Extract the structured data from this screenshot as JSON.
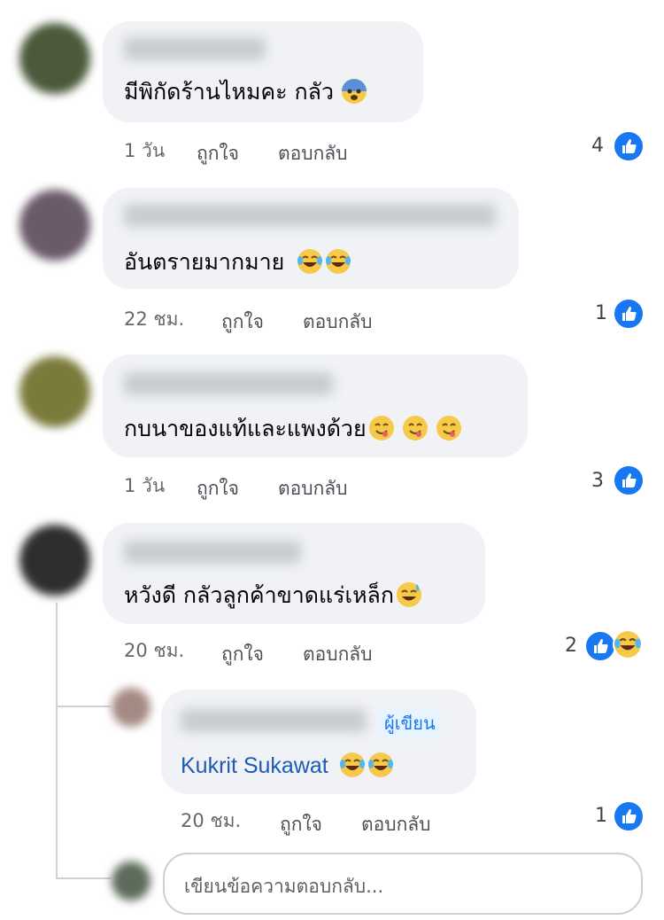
{
  "comments": [
    {
      "text": "มีพิกัดร้านไหมคะ กลัว",
      "time": "1 วัน",
      "like_label": "ถูกใจ",
      "reply_label": "ตอบกลับ",
      "count": "4"
    },
    {
      "text": "อันตรายมากมาย",
      "time": "22 ชม.",
      "like_label": "ถูกใจ",
      "reply_label": "ตอบกลับ",
      "count": "1"
    },
    {
      "text": "กบนาของแท้และแพงด้วย",
      "time": "1 วัน",
      "like_label": "ถูกใจ",
      "reply_label": "ตอบกลับ",
      "count": "3"
    },
    {
      "text": "หวังดี กลัวลูกค้าขาดแร่เหล็ก",
      "time": "20 ชม.",
      "like_label": "ถูกใจ",
      "reply_label": "ตอบกลับ",
      "count": "2"
    }
  ],
  "reply": {
    "author_badge": "ผู้เขียน",
    "mention": "Kukrit Sukawat",
    "time": "20 ชม.",
    "like_label": "ถูกใจ",
    "reply_label": "ตอบกลับ",
    "count": "1"
  },
  "reply_input": {
    "placeholder": "เขียนข้อความตอบกลับ..."
  },
  "colors": {
    "bubble": "#f0f2f5",
    "accent": "#1877f2",
    "meta": "#65676b"
  }
}
